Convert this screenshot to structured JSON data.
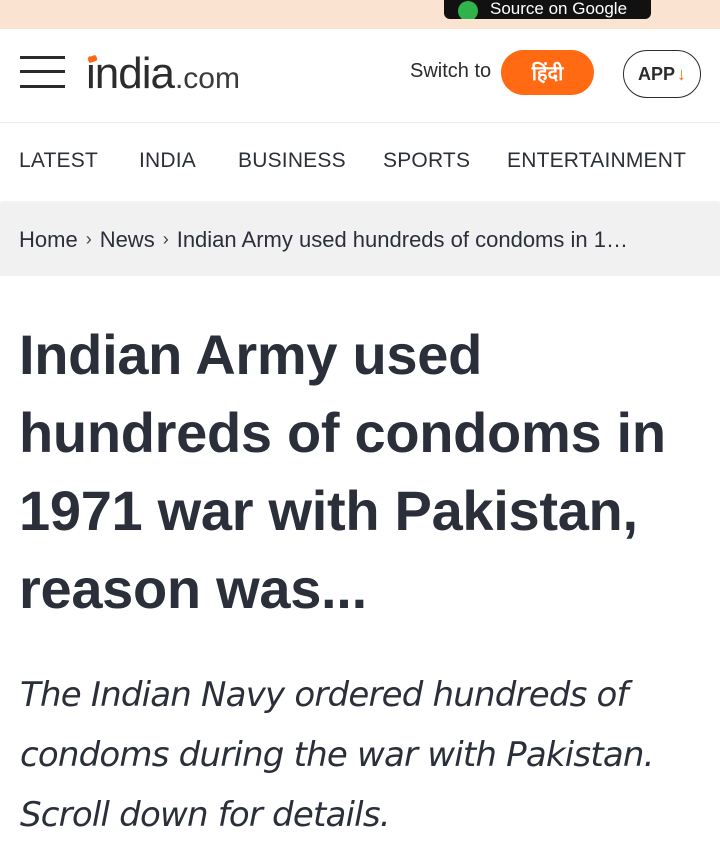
{
  "promo": {
    "badge_text": "Source on Google"
  },
  "header": {
    "logo_main": "india",
    "logo_tld": ".com",
    "switch_label": "Switch to",
    "hindi_button": "हिंदी",
    "app_button": "APP",
    "app_arrow": "↓"
  },
  "nav": {
    "categories": [
      "LATEST",
      "INDIA",
      "BUSINESS",
      "SPORTS",
      "ENTERTAINMENT"
    ]
  },
  "breadcrumb": {
    "home": "Home",
    "news": "News",
    "current": "Indian Army used hundreds of condoms in 1…",
    "separator": "›"
  },
  "article": {
    "headline": "Indian Army used hundreds of condoms in 1971 war with Pakistan, reason was...",
    "summary": "The Indian Navy ordered hundreds of condoms during the war with Pakistan. Scroll down for details."
  },
  "colors": {
    "accent": "#ff6a13",
    "promo_bg": "#fbe3d1",
    "breadcrumb_bg": "#f1f1f1",
    "text": "#2b2f3a"
  },
  "icons": {
    "menu": "hamburger-menu-icon",
    "download": "download-arrow-icon",
    "chevron": "chevron-right-icon",
    "google": "google-logo-icon"
  }
}
